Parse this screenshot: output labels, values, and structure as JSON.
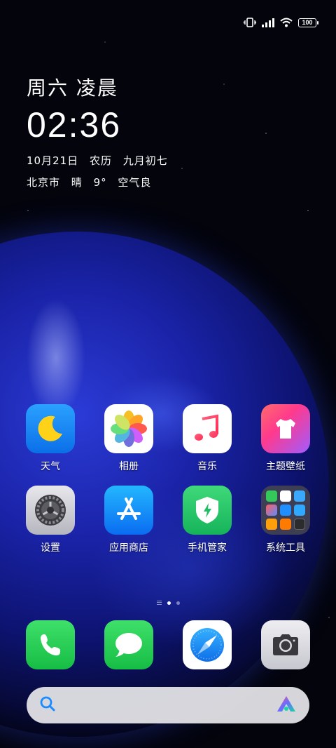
{
  "status_bar": {
    "icons": [
      "vibrate-icon",
      "signal-icon",
      "wifi-icon"
    ],
    "battery": "100"
  },
  "clock": {
    "day": "周六 凌晨",
    "time": "02:36",
    "date": "10月21日",
    "lunar_label": "农历",
    "lunar_date": "九月初七",
    "city": "北京市",
    "weather": "晴",
    "temp": "9°",
    "air": "空气良"
  },
  "apps": {
    "row1": [
      {
        "label": "天气",
        "icon": "weather-moon-icon"
      },
      {
        "label": "相册",
        "icon": "photos-icon"
      },
      {
        "label": "音乐",
        "icon": "music-note-icon"
      },
      {
        "label": "主题壁纸",
        "icon": "themes-shirt-icon"
      }
    ],
    "row2": [
      {
        "label": "设置",
        "icon": "settings-gear-icon"
      },
      {
        "label": "应用商店",
        "icon": "app-store-icon"
      },
      {
        "label": "手机管家",
        "icon": "security-shield-icon"
      },
      {
        "label": "系统工具",
        "icon": "folder-icon"
      }
    ]
  },
  "dock": [
    "phone-icon",
    "messages-icon",
    "browser-compass-icon",
    "camera-icon"
  ],
  "search": {
    "icon": "search-icon",
    "assistant_icon": "assistant-logo-icon"
  },
  "colors": {
    "search_icon": "#1a8cff",
    "folder_bg": "#46464f"
  }
}
